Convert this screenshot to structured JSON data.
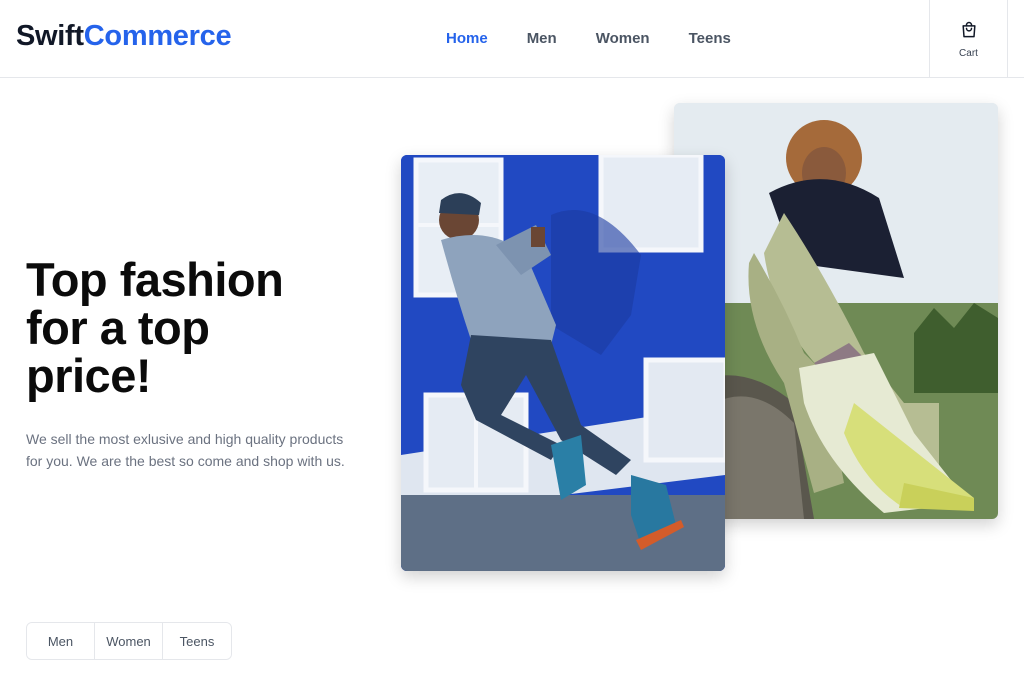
{
  "brand": {
    "part1": "Swift",
    "part2": "Commerce"
  },
  "nav": {
    "items": [
      {
        "label": "Home",
        "active": true
      },
      {
        "label": "Men",
        "active": false
      },
      {
        "label": "Women",
        "active": false
      },
      {
        "label": "Teens",
        "active": false
      }
    ]
  },
  "cart": {
    "label": "Cart",
    "icon": "shopping-bag-icon"
  },
  "hero": {
    "headline": "Top fashion for a top price!",
    "description": "We sell the most exlusive and high quality products for you. We are the best so come and shop with us."
  },
  "filters": {
    "items": [
      "Men",
      "Women",
      "Teens"
    ]
  },
  "colors": {
    "accent": "#2563eb",
    "text": "#111827",
    "muted": "#6b7280",
    "border": "#e5e7eb"
  }
}
